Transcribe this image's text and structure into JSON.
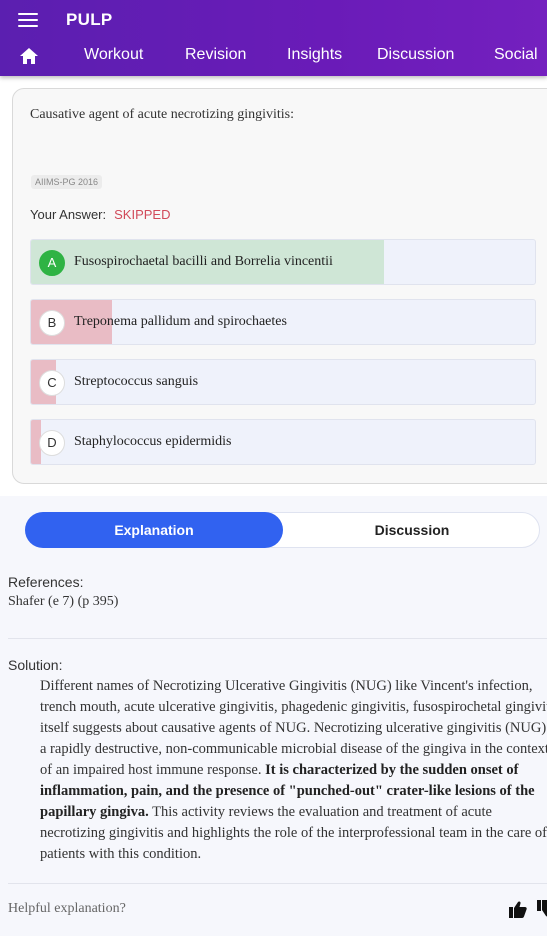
{
  "header": {
    "title": "PULP",
    "tabs": [
      {
        "label": "Workout"
      },
      {
        "label": "Revision"
      },
      {
        "label": "Insights"
      },
      {
        "label": "Discussion"
      },
      {
        "label": "Social"
      }
    ],
    "icons": {
      "menu": "menu-icon",
      "home": "home-icon"
    },
    "accent": "#6a1bb8"
  },
  "question": {
    "text": "Causative agent of acute necrotizing gingivitis:",
    "tag": "AIIMS-PG 2016",
    "your_answer_label": "Your Answer:",
    "your_answer_status": "SKIPPED",
    "options": [
      {
        "letter": "A",
        "text": "Fusospirochaetal bacilli and Borrelia vincentii",
        "correct": true,
        "response_fraction": 0.7,
        "fill_color": "#cfe6d6"
      },
      {
        "letter": "B",
        "text": "Treponema pallidum and spirochaetes",
        "correct": false,
        "response_fraction": 0.16,
        "fill_color": "#e9bcc5"
      },
      {
        "letter": "C",
        "text": "Streptococcus sanguis",
        "correct": false,
        "response_fraction": 0.05,
        "fill_color": "#e9bcc5"
      },
      {
        "letter": "D",
        "text": "Staphylococcus epidermidis",
        "correct": false,
        "response_fraction": 0.02,
        "fill_color": "#e9bcc5"
      }
    ]
  },
  "tabs": {
    "explanation": "Explanation",
    "discussion": "Discussion",
    "active_color": "#3162f0"
  },
  "references": {
    "label": "References:",
    "text": "Shafer (e 7) (p 395)"
  },
  "solution": {
    "label": "Solution:",
    "text_1": "Different names of Necrotizing Ulcerative Gingivitis (NUG) like Vincent's infection, trench mouth, acute ulcerative gingivitis, phagedenic gingivitis, fusospirochetal gingivitis itself suggests about causative agents of NUG. Necrotizing ulcerative gingivitis (NUG) is a rapidly destructive, non-communicable microbial disease of the gingiva in the context of an impaired host immune response. ",
    "text_bold": "It is characterized by the sudden onset of inflammation, pain, and the presence of \"punched-out\" crater-like lesions of the papillary gingiva.",
    "text_2": " This activity reviews the evaluation and treatment of acute necrotizing gingivitis and highlights the role of the interprofessional team in the care of patients with this condition."
  },
  "feedback": {
    "prompt": "Helpful explanation?",
    "up_icon": "thumbs-up-icon",
    "down_icon": "thumbs-down-icon"
  }
}
